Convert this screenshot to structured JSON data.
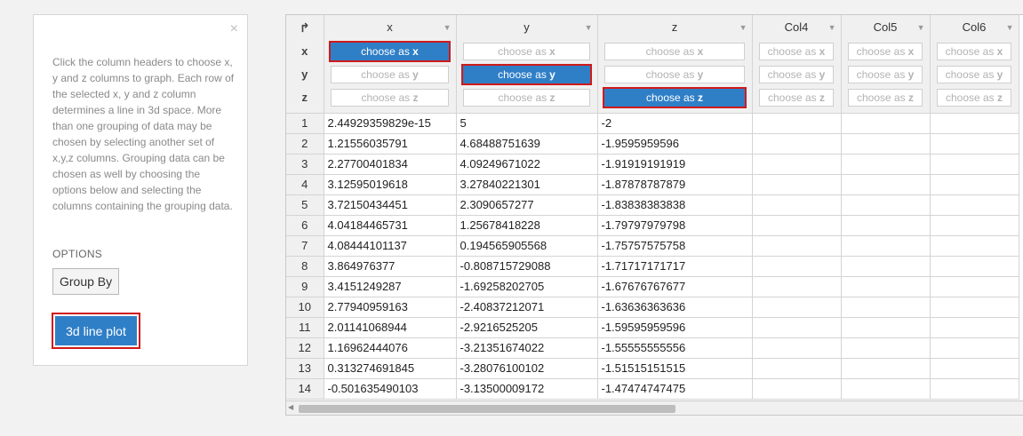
{
  "panel": {
    "close": "×",
    "help_text": "Click the column headers to choose x, y and z columns to graph. Each row of the selected x, y and z column determines a line in 3d space. More than one grouping of data may be chosen by selecting another set of x,y,z columns. Grouping data can be chosen as well by choosing the options below and selecting the columns containing the grouping data.",
    "options_label": "OPTIONS",
    "group_by_label": "Group By",
    "plot_label": "3d line plot"
  },
  "grid": {
    "corner_icon": "↱",
    "axis_labels": [
      "x",
      "y",
      "z"
    ],
    "choose_prefix": "choose as",
    "columns": [
      {
        "name": "x",
        "selected": "x"
      },
      {
        "name": "y",
        "selected": "y"
      },
      {
        "name": "z",
        "selected": "z"
      },
      {
        "name": "Col4",
        "selected": null
      },
      {
        "name": "Col5",
        "selected": null
      },
      {
        "name": "Col6",
        "selected": null
      }
    ],
    "rows": [
      [
        "1",
        "2.44929359829e-15",
        "5",
        "-2"
      ],
      [
        "2",
        "1.21556035791",
        "4.68488751639",
        "-1.9595959596"
      ],
      [
        "3",
        "2.27700401834",
        "4.09249671022",
        "-1.91919191919"
      ],
      [
        "4",
        "3.12595019618",
        "3.27840221301",
        "-1.87878787879"
      ],
      [
        "5",
        "3.72150434451",
        "2.3090657277",
        "-1.83838383838"
      ],
      [
        "6",
        "4.04184465731",
        "1.25678418228",
        "-1.79797979798"
      ],
      [
        "7",
        "4.08444101137",
        "0.194565905568",
        "-1.75757575758"
      ],
      [
        "8",
        "3.864976377",
        "-0.808715729088",
        "-1.71717171717"
      ],
      [
        "9",
        "3.4151249287",
        "-1.69258202705",
        "-1.67676767677"
      ],
      [
        "10",
        "2.77940959163",
        "-2.40837212071",
        "-1.63636363636"
      ],
      [
        "11",
        "2.01141068944",
        "-2.9216525205",
        "-1.59595959596"
      ],
      [
        "12",
        "1.16962444076",
        "-3.21351674022",
        "-1.55555555556"
      ],
      [
        "13",
        "0.313274691845",
        "-3.28076100102",
        "-1.51515151515"
      ],
      [
        "14",
        "-0.501635490103",
        "-3.13500009172",
        "-1.47474747475"
      ]
    ]
  },
  "colors": {
    "accent": "#2f7fc7",
    "highlight": "#d01a1a"
  }
}
